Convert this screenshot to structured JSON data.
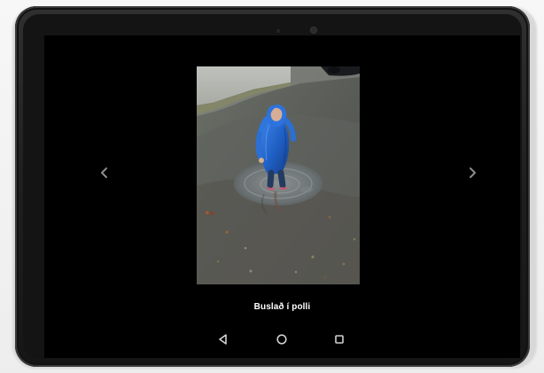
{
  "gallery": {
    "caption": "Buslað í polli"
  },
  "icons": {
    "prev": "chevron-left-icon",
    "next": "chevron-right-icon",
    "back": "back-triangle-icon",
    "home": "home-circle-icon",
    "recents": "recents-square-icon"
  },
  "colors": {
    "screen": "#000000",
    "tablet": "#202020",
    "caption": "#ffffff",
    "jacket": "#1f5fc4"
  }
}
